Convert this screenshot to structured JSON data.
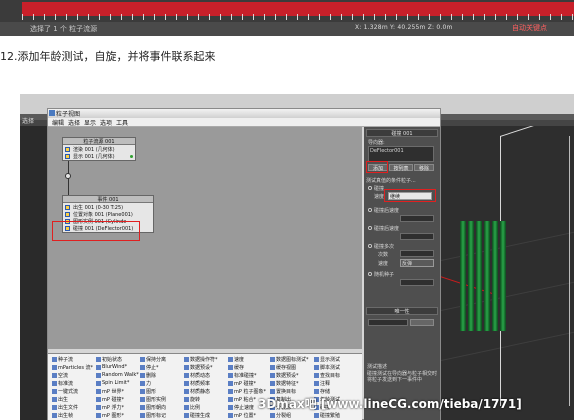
{
  "top_strip": {
    "status_text": "选择了 1 个 粒子流源",
    "fields": "X: 1.328m  Y: 40.255m  Z: 0.0m",
    "right_label": "自动关键点"
  },
  "caption": "12.添加年龄测试，自旋，并将事件联系起来",
  "screenshot": {
    "header_label": "选择",
    "window": {
      "title": "粒子视图",
      "menu": [
        "编辑",
        "选择",
        "显示",
        "选项",
        "工具"
      ]
    },
    "nodes": {
      "source": {
        "title": "粒子流源 001",
        "rows": [
          "渲染 001 (几何体)",
          "显示 001 (几何体)"
        ]
      },
      "event": {
        "title": "事件 001",
        "rows": [
          "出生 001 (0-30 T:25)",
          "位置对象 001 (Plane001)",
          "图形实例 001 (Cylinde",
          "碰撞 001 (DeFlector001)"
        ]
      }
    },
    "params": {
      "header": "碰撞 001",
      "deflectors_label": "导向器:",
      "deflector_item": "DeFlector001",
      "btn_add": "添加",
      "btn_list": "按列表",
      "btn_remove": "移除",
      "test_label": "测试真值的条件粒子...",
      "option_collide": "碰撞",
      "speed_label": "速度",
      "speed_value": "继续",
      "option_multi": "碰撞后速度",
      "option_more": "碰撞后速度",
      "sub_label": "碰撞多次",
      "count_label": "次数",
      "speed_label2": "速度",
      "speed_value2": "反弹",
      "option_random": "随机种子",
      "multi_header": "唯一性",
      "desc_header": "测试描述",
      "desc_text": "碰撞测试在导向器与粒子相交时将粒子发送到下一事件中"
    },
    "depot": [
      [
        "种子流",
        "初始状态",
        "保持分离",
        "数据操作符*",
        "速度",
        "数据图标测试*",
        "显示测试"
      ],
      [
        "mParticles 流*",
        "BlurWind*",
        "停止*",
        "数据预设*",
        "缓存",
        "缓存视图",
        "脚本测试"
      ],
      [
        "空流",
        "Random Walk*",
        "删除",
        "材质动态",
        "标准碰撞*",
        "数据预设*",
        "查找目标"
      ],
      [
        "标准流",
        "Spin Limit*",
        "力",
        "材质频率",
        "mP 碰撞*",
        "数据特征*",
        "注释"
      ],
      [
        "一键式流",
        "mP 世界*",
        "图形",
        "材质静态",
        "mP 粒子图象*",
        "置换目标",
        "存储"
      ],
      [
        "出生",
        "mP 碰撞*",
        "图形实例",
        "旋转",
        "mP 粘合*",
        "复制出",
        "年龄测试"
      ],
      [
        "出生文件",
        "mP 浮力*",
        "图形朝向",
        "比例",
        "停止速度",
        "分裂源",
        "碰撞"
      ],
      [
        "出生帧",
        "mP 图形*",
        "图形标记",
        "碰撞生成",
        "mP 位置*",
        "分裂组",
        "碰撞繁殖"
      ]
    ],
    "watermark": "3Dmax吧 [www.lineCG.com/tieba/1771]"
  }
}
